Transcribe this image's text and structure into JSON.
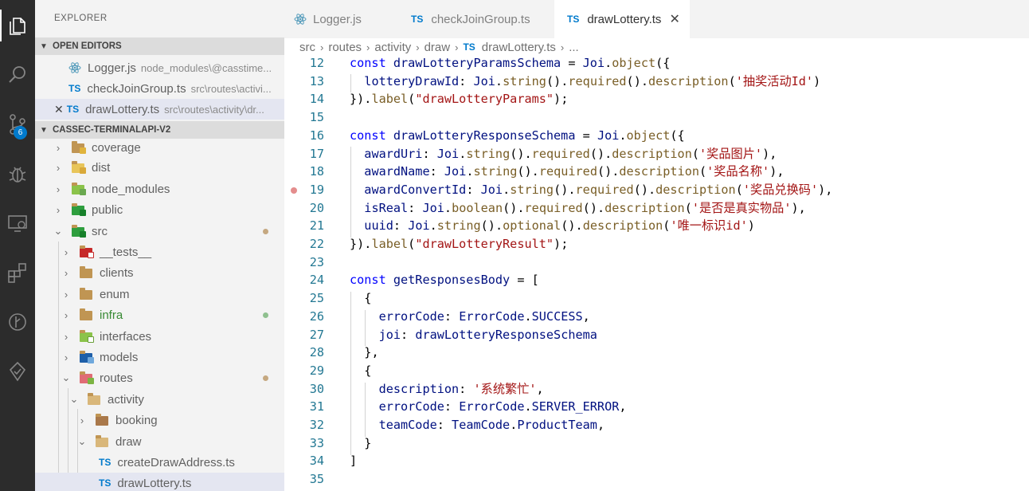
{
  "sidebar": {
    "title": "EXPLORER",
    "open_editors": {
      "header": "OPEN EDITORS",
      "items": [
        {
          "name": "Logger.js",
          "desc": "node_modules\\@casstime..."
        },
        {
          "name": "checkJoinGroup.ts",
          "desc": "src\\routes\\activi..."
        },
        {
          "name": "drawLottery.ts",
          "desc": "src\\routes\\activity\\dr..."
        }
      ],
      "ts_tag": "TS",
      "close_glyph": "✕"
    },
    "project": {
      "header": "CASSEC-TERMINALAPI-V2",
      "tree": [
        {
          "name": "coverage"
        },
        {
          "name": "dist"
        },
        {
          "name": "node_modules"
        },
        {
          "name": "public"
        },
        {
          "name": "src"
        },
        {
          "name": "__tests__"
        },
        {
          "name": "clients"
        },
        {
          "name": "enum"
        },
        {
          "name": "infra"
        },
        {
          "name": "interfaces"
        },
        {
          "name": "models"
        },
        {
          "name": "routes"
        },
        {
          "name": "activity"
        },
        {
          "name": "booking"
        },
        {
          "name": "draw"
        },
        {
          "name": "createDrawAddress.ts"
        },
        {
          "name": "drawLottery.ts"
        }
      ]
    }
  },
  "activity_bar": {
    "icons": [
      "files-icon",
      "search-icon",
      "source-control-icon",
      "debug-icon",
      "remote-explorer-icon",
      "extensions-icon",
      "git-graph-icon",
      "test-icon"
    ],
    "scm_badge": "6"
  },
  "tabs": [
    {
      "label": "Logger.js",
      "active": false
    },
    {
      "label": "checkJoinGroup.ts",
      "active": false
    },
    {
      "label": "drawLottery.ts",
      "active": true
    }
  ],
  "tab_close": "✕",
  "breadcrumb": [
    "src",
    "routes",
    "activity",
    "draw",
    "drawLottery.ts",
    "..."
  ],
  "editor": {
    "line_numbers": [
      "12",
      "13",
      "14",
      "15",
      "16",
      "17",
      "18",
      "19",
      "20",
      "21",
      "22",
      "23",
      "24",
      "25",
      "26",
      "27",
      "28",
      "29",
      "30",
      "31",
      "32",
      "33",
      "34",
      "35"
    ],
    "breakpoint_line": "19"
  },
  "colors": {
    "accent": "#007acc",
    "activity_bar": "#2c2c2c",
    "sidebar_bg": "#f3f3f3",
    "line_number": "#237893",
    "keyword": "#0000ff",
    "string": "#a31515",
    "function": "#795e26",
    "variable": "#001080",
    "type": "#267f99",
    "modified_dot": "#c5a880",
    "untracked_dot": "#8fc08f"
  }
}
